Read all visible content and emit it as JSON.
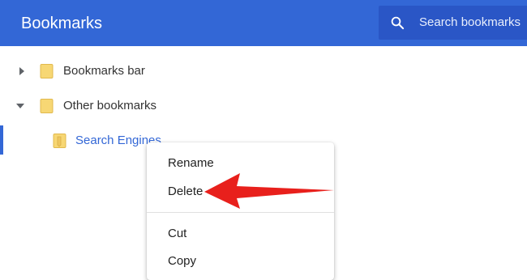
{
  "header": {
    "title": "Bookmarks",
    "search_placeholder": "Search bookmarks",
    "search_icon": "search-icon"
  },
  "tree": {
    "items": [
      {
        "label": "Bookmarks bar",
        "expanded": false,
        "icon": "folder-icon"
      },
      {
        "label": "Other bookmarks",
        "expanded": true,
        "icon": "folder-icon"
      },
      {
        "label": "Search Engines",
        "selected": true,
        "icon": "folder-icon"
      }
    ]
  },
  "context_menu": {
    "items": [
      {
        "label": "Rename"
      },
      {
        "label": "Delete"
      },
      {
        "label": "Cut"
      },
      {
        "label": "Copy"
      }
    ]
  },
  "colors": {
    "header_bg": "#3367d6",
    "search_bg": "#2a56c6",
    "folder": "#f7d774",
    "selected_text": "#3367d6",
    "arrow": "#e8201c"
  }
}
